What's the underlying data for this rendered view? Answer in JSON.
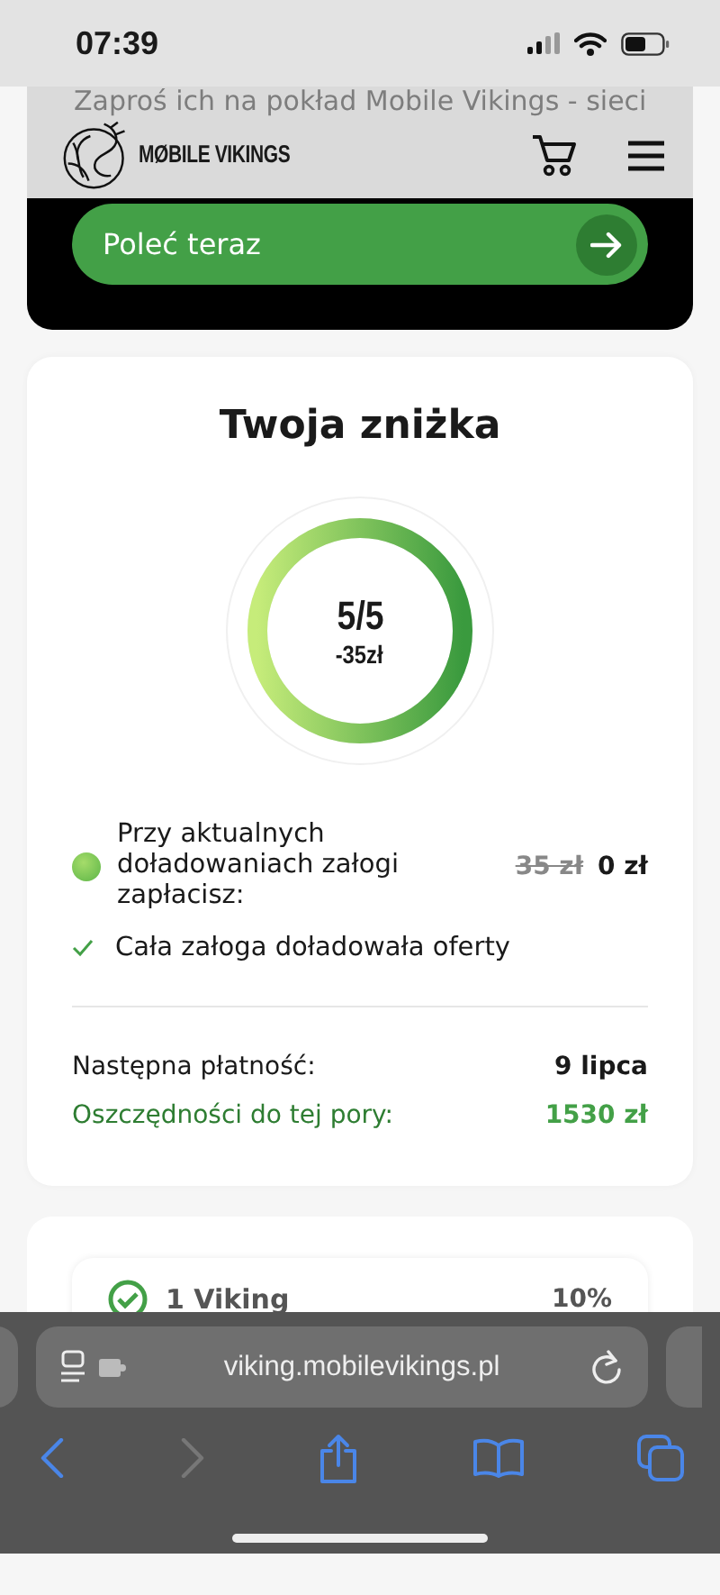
{
  "status_bar": {
    "time": "07:39"
  },
  "header": {
    "logo_text": "MØBILE VIKINGS"
  },
  "referral": {
    "lines": [
      "Zaproś ich na pokład Mobile Vikings - sieci"
    ],
    "button": "Poleć teraz"
  },
  "discount": {
    "title": "Twoja zniżka",
    "progress": {
      "level": 1,
      "count": "5/5",
      "amount": "-35zł"
    },
    "price_row": {
      "label": "Przy aktualnych doładowaniach załogi zapłacisz:",
      "old_price": "35 zł",
      "new_price": "0 zł"
    },
    "checks": [
      {
        "text": "Cała załoga doładowała oferty",
        "checked": true
      }
    ],
    "details": [
      {
        "label": "Następna płatność:",
        "value": "9 lipca",
        "highlight": false
      },
      {
        "label": "Oszczędności do tej pory:",
        "value": "1530 zł",
        "highlight": true
      }
    ]
  },
  "crew": {
    "items": [
      {
        "name": "1 Viking",
        "value": "10%",
        "done": true
      }
    ]
  },
  "browser": {
    "url": "viking.mobilevikings.pl",
    "back_enabled": true,
    "forward_enabled": false
  }
}
